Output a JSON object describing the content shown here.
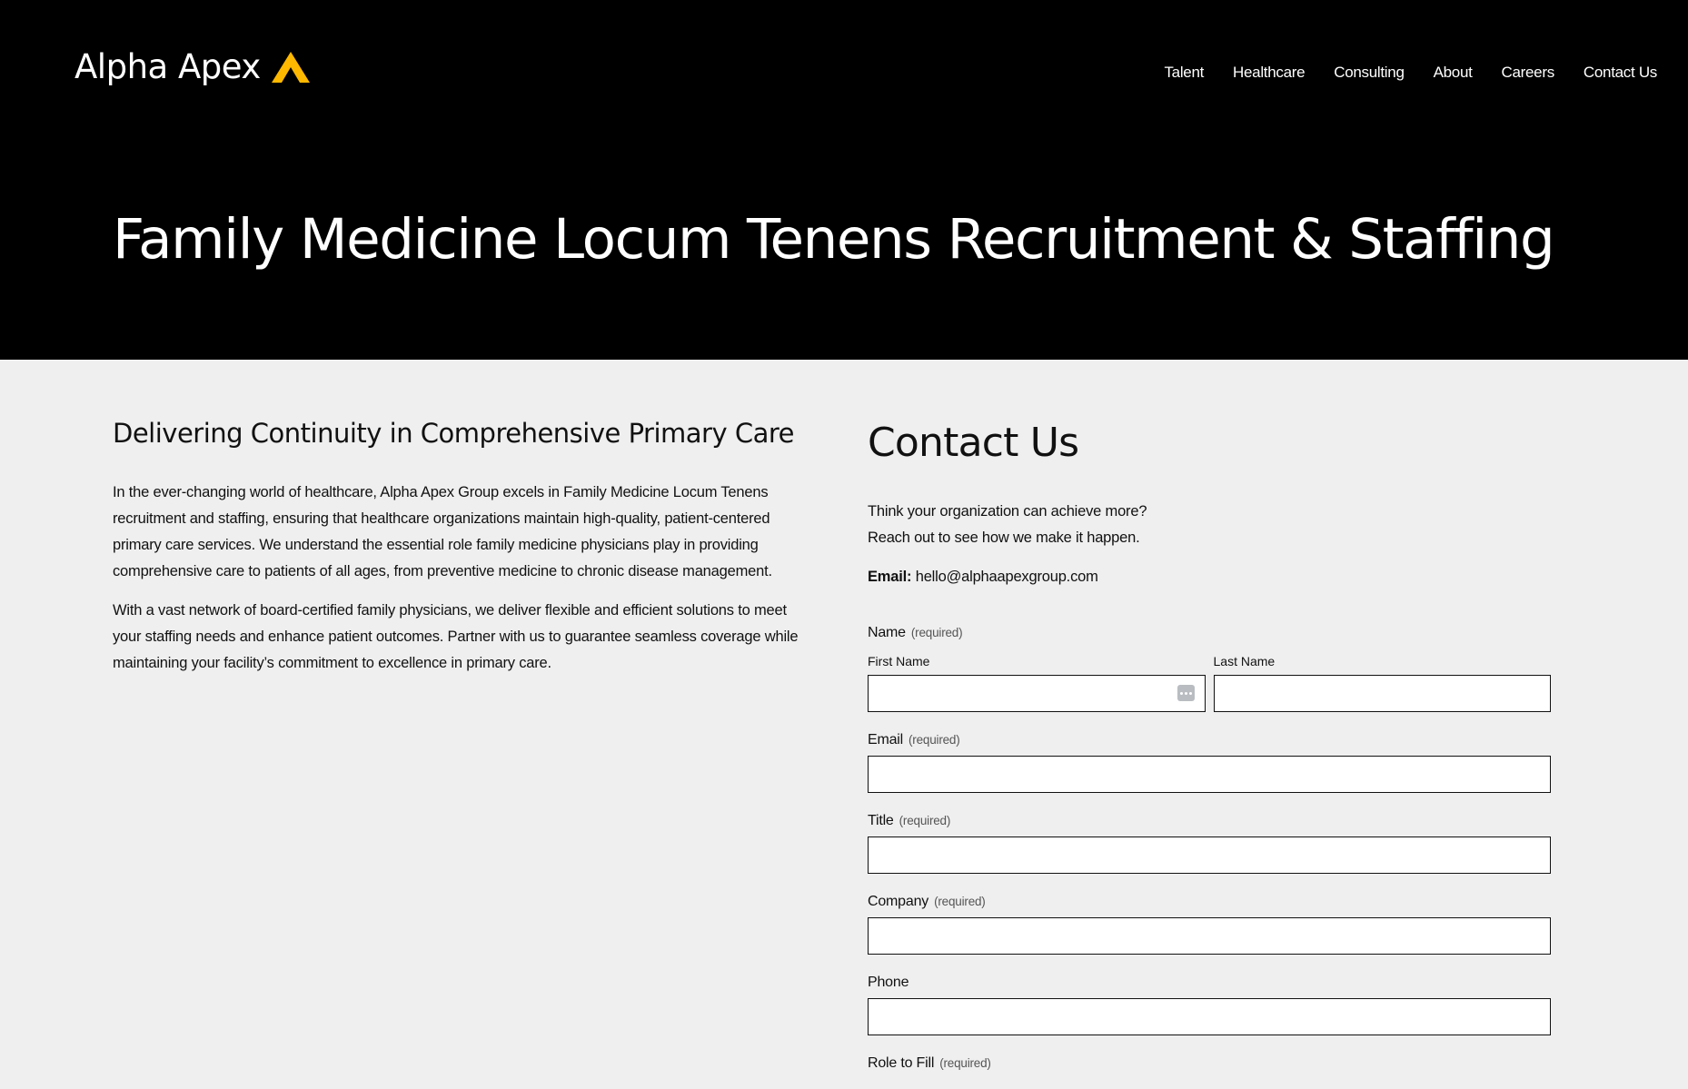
{
  "brand": {
    "name": "Alpha Apex",
    "accent_color": "#FFC107",
    "logo_icon": "apex-triangle-icon"
  },
  "nav": {
    "items": [
      "Talent",
      "Healthcare",
      "Consulting",
      "About",
      "Careers",
      "Contact Us"
    ]
  },
  "hero": {
    "title": "Family Medicine Locum Tenens Recruitment & Staffing"
  },
  "content": {
    "heading": "Delivering Continuity in Comprehensive Primary Care",
    "paragraphs": [
      "In the ever-changing world of healthcare, Alpha Apex Group excels in Family Medicine Locum Tenens recruitment and staffing, ensuring that healthcare organizations maintain high-quality, patient-centered primary care services. We understand the essential role family medicine physicians play in providing comprehensive care to patients of all ages, from preventive medicine to chronic disease management.",
      "With a vast network of board-certified family physicians, we deliver flexible and efficient solutions to meet your staffing needs and enhance patient outcomes. Partner with us to guarantee seamless coverage while maintaining your facility’s commitment to excellence in primary care."
    ]
  },
  "contact": {
    "title": "Contact Us",
    "intro_line1": "Think your organization can achieve more?",
    "intro_line2": "Reach out to see how we make it happen.",
    "email_label": "Email:",
    "email_value": "hello@alphaapexgroup.com"
  },
  "form": {
    "required_text": "(required)",
    "name_label": "Name",
    "first_name_label": "First Name",
    "first_name_value": "",
    "last_name_label": "Last Name",
    "last_name_value": "",
    "autofill_icon": "autofill-more-icon",
    "email_label": "Email",
    "email_value": "",
    "title_label": "Title",
    "title_value": "",
    "company_label": "Company",
    "company_value": "",
    "phone_label": "Phone",
    "phone_value": "",
    "role_label": "Role to Fill"
  }
}
